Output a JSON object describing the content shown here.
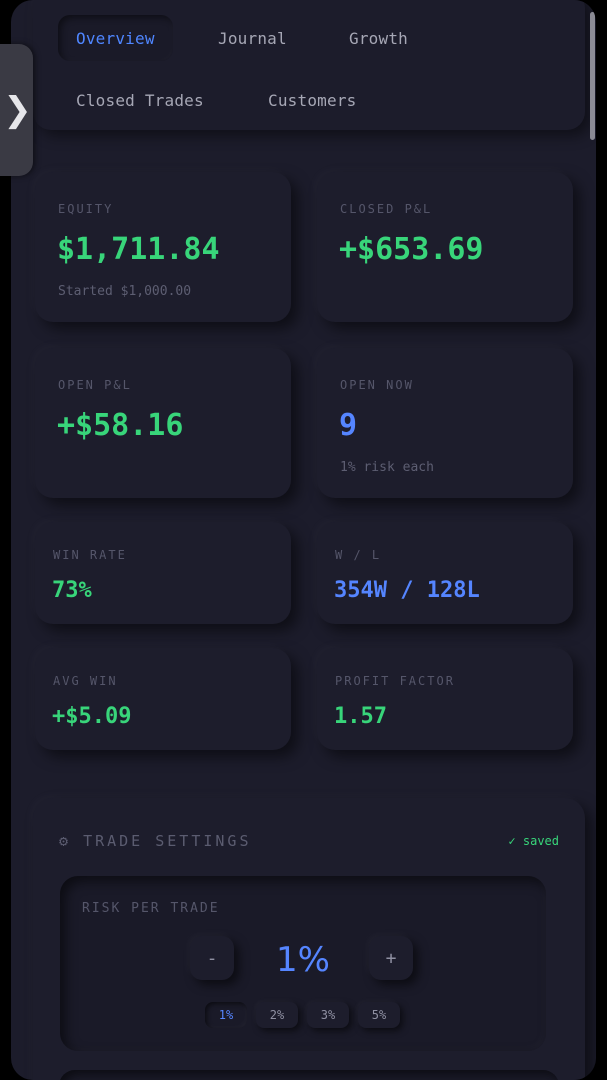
{
  "tabs": [
    {
      "label": "Overview",
      "active": true
    },
    {
      "label": "Journal",
      "active": false
    },
    {
      "label": "Growth",
      "active": false
    },
    {
      "label": "Closed Trades",
      "active": false
    },
    {
      "label": "Customers",
      "active": false
    }
  ],
  "drawer_handle": {
    "glyph": "❯",
    "icon": "chevron-right-icon"
  },
  "stats": {
    "equity": {
      "label": "EQUITY",
      "value": "$1,711.84",
      "sub": "Started $1,000.00"
    },
    "closed_pnl": {
      "label": "CLOSED P&L",
      "value": "+$653.69"
    },
    "open_pnl": {
      "label": "OPEN P&L",
      "value": "+$58.16"
    },
    "open_now": {
      "label": "OPEN NOW",
      "value": "9",
      "sub": "1% risk each"
    },
    "win_rate": {
      "label": "WIN RATE",
      "value": "73%"
    },
    "wl": {
      "label": "W / L",
      "value": "354W / 128L"
    },
    "avg_win": {
      "label": "AVG WIN",
      "value": "+$5.09"
    },
    "profit_factor": {
      "label": "PROFIT FACTOR",
      "value": "1.57"
    }
  },
  "settings": {
    "icon": "gear-icon",
    "icon_glyph": "⚙",
    "title": "TRADE SETTINGS",
    "saved": "✓ saved",
    "risk": {
      "label": "RISK PER TRADE",
      "value": "1%",
      "minus": "-",
      "plus": "+",
      "options": [
        "1%",
        "2%",
        "3%",
        "5%"
      ],
      "selected": "1%"
    }
  },
  "colors": {
    "background": "#1c1c2b",
    "positive": "#38d57a",
    "accent": "#5585ff"
  }
}
